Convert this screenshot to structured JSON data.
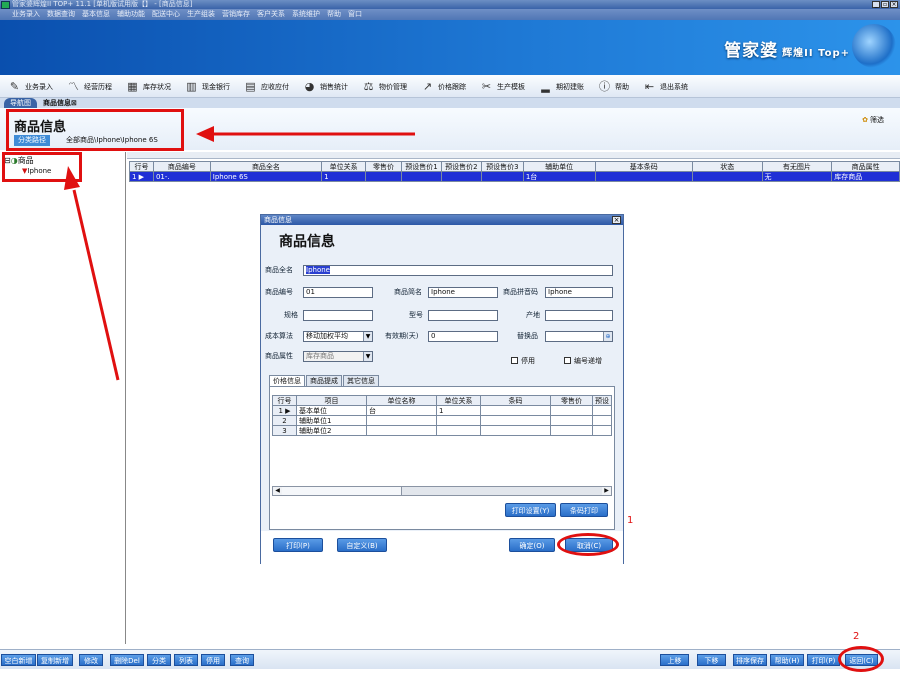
{
  "window": {
    "title": "管家婆辉煌II TOP+ 11.1 [单机版试用版【】 - [商品信息]",
    "controls": [
      "_",
      "▫",
      "×"
    ]
  },
  "menu": [
    "业务录入",
    "数据查询",
    "基本信息",
    "辅助功能",
    "配送中心",
    "生产组装",
    "营销库存",
    "客户关系",
    "系统维护",
    "帮助",
    "窗口"
  ],
  "brand": {
    "main": "管家婆",
    "sub": "辉煌II Top+"
  },
  "toolbar": [
    {
      "label": "业务录入",
      "icon": "pencil-icon",
      "glyph": "✎"
    },
    {
      "label": "经营历程",
      "icon": "chart-icon",
      "glyph": "〽"
    },
    {
      "label": "库存状况",
      "icon": "box-icon",
      "glyph": "▦"
    },
    {
      "label": "现金银行",
      "icon": "bank-icon",
      "glyph": "▥"
    },
    {
      "label": "应收应付",
      "icon": "ledger-icon",
      "glyph": "▤"
    },
    {
      "label": "销售统计",
      "icon": "pie-icon",
      "glyph": "◕"
    },
    {
      "label": "物价管理",
      "icon": "price-icon",
      "glyph": "⚖"
    },
    {
      "label": "价格跟踪",
      "icon": "trend-icon",
      "glyph": "↗"
    },
    {
      "label": "生产模板",
      "icon": "tools-icon",
      "glyph": "✂"
    },
    {
      "label": "期初建账",
      "icon": "setup-icon",
      "glyph": "▂"
    },
    {
      "label": "帮助",
      "icon": "help-icon",
      "glyph": "ⓘ"
    },
    {
      "label": "退出系统",
      "icon": "exit-icon",
      "glyph": "⇤"
    }
  ],
  "tabs": {
    "nav": "导航图",
    "current": "商品信息⊠"
  },
  "page": {
    "title": "商品信息",
    "path_button": "分类路径",
    "path_text": "全部商品\\Iphone\\Iphone 6S",
    "filter": "筛选"
  },
  "tree": {
    "root": "商品",
    "child": "Iphone"
  },
  "grid": {
    "headers": [
      "行号",
      "商品编号",
      "商品全名",
      "单位关系",
      "零售价",
      "预设售价1",
      "预设售价2",
      "预设售价3",
      "辅助单位",
      "基本条码",
      "状态",
      "有无图片",
      "商品属性"
    ],
    "widths": [
      24,
      57,
      112,
      44,
      36,
      40,
      40,
      42,
      72,
      98,
      70,
      70,
      68
    ],
    "rows": [
      [
        "1 ▶",
        "01-.",
        "Iphone 6S",
        "1",
        "",
        "",
        "",
        "",
        "1台",
        "",
        "",
        "无",
        "库存商品"
      ]
    ]
  },
  "dialog": {
    "title": "商品信息",
    "heading": "商品信息",
    "fields": {
      "full_name_label": "商品全名",
      "full_name": "Iphone",
      "code_label": "商品编号",
      "code": "01",
      "short_label": "商品简名",
      "short": "Iphone",
      "pinyin_label": "商品拼音码",
      "pinyin": "Iphone",
      "spec_label": "规格",
      "spec": "",
      "model_label": "型号",
      "model": "",
      "origin_label": "产地",
      "origin": "",
      "cost_label": "成本算法",
      "cost": "移动加权平均",
      "valid_label": "有效期(天)",
      "valid": "0",
      "replace_label": "替换品",
      "replace": "",
      "attr_label": "商品属性",
      "attr": "库存商品"
    },
    "checks": {
      "disable": "停用",
      "autocode": "编号递增"
    },
    "tabs": [
      "价格信息",
      "商品提成",
      "其它信息"
    ],
    "grid": {
      "headers": [
        "行号",
        "项目",
        "单位名称",
        "单位关系",
        "条码",
        "零售价",
        "预设"
      ],
      "widths": [
        24,
        70,
        70,
        44,
        70,
        42,
        14
      ],
      "rows": [
        [
          "1 ▶",
          "基本单位",
          "台",
          "1",
          "",
          "",
          ""
        ],
        [
          "2",
          "辅助单位1",
          "",
          "",
          "",
          "",
          ""
        ],
        [
          "3",
          "辅助单位2",
          "",
          "",
          "",
          "",
          ""
        ]
      ]
    },
    "buttons": {
      "print_setup": "打印设置(Y)",
      "barcode_print": "条码打印",
      "print": "打印(P)",
      "custom": "自定义(B)",
      "ok": "确定(O)",
      "cancel": "取消(C)"
    }
  },
  "footer": {
    "left": [
      "空白新增",
      "复制新增",
      "修改",
      "删除Del",
      "分类",
      "列表",
      "停用",
      "查询"
    ],
    "right": [
      "上移",
      "下移",
      "排序保存",
      "帮助(H)",
      "打印(P)",
      "返回(C)"
    ]
  },
  "annotations": {
    "n1": "1",
    "n2": "2"
  },
  "colors": {
    "highlight": "#e01010",
    "accent": "#2a6ec8",
    "selection": "#1f2fd6"
  }
}
